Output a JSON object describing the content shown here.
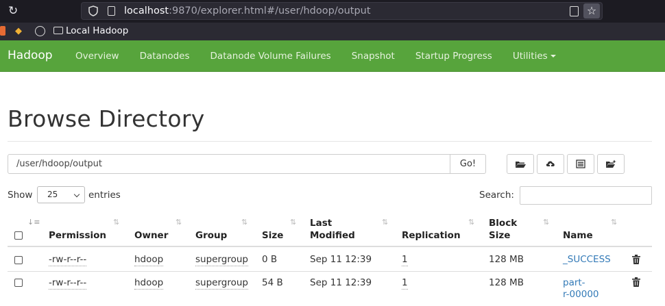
{
  "browser": {
    "url_host": "localhost",
    "url_rest": ":9870/explorer.html#/user/hdoop/output",
    "bookmark_folder": "Local Hadoop"
  },
  "navbar": {
    "brand": "Hadoop",
    "links": [
      "Overview",
      "Datanodes",
      "Datanode Volume Failures",
      "Snapshot",
      "Startup Progress",
      "Utilities"
    ]
  },
  "page": {
    "title": "Browse Directory",
    "path_value": "/user/hdoop/output",
    "go_label": "Go!",
    "show_label": "Show",
    "entries_value": "25",
    "entries_label": "entries",
    "search_label": "Search:"
  },
  "table": {
    "headers": {
      "permission": "Permission",
      "owner": "Owner",
      "group": "Group",
      "size": "Size",
      "last_modified_1": "Last",
      "last_modified_2": "Modified",
      "replication": "Replication",
      "block_size_1": "Block",
      "block_size_2": "Size",
      "name": "Name"
    },
    "rows": [
      {
        "permission": "-rw-r--r--",
        "owner": "hdoop",
        "group": "supergroup",
        "size": "0 B",
        "modified": "Sep 11 12:39",
        "replication": "1",
        "block_size": "128 MB",
        "name_1": "_SUCCESS",
        "name_2": ""
      },
      {
        "permission": "-rw-r--r--",
        "owner": "hdoop",
        "group": "supergroup",
        "size": "54 B",
        "modified": "Sep 11 12:39",
        "replication": "1",
        "block_size": "128 MB",
        "name_1": "part-",
        "name_2": "r-00000"
      }
    ]
  },
  "colors": {
    "navbar": "#57a43c",
    "link": "#337ab7"
  },
  "icons": [
    "reload-icon",
    "shield-icon",
    "page-icon",
    "reader-icon",
    "star-icon",
    "folder-icon",
    "upload-icon",
    "list-icon",
    "new-folder-icon",
    "trash-icon"
  ]
}
